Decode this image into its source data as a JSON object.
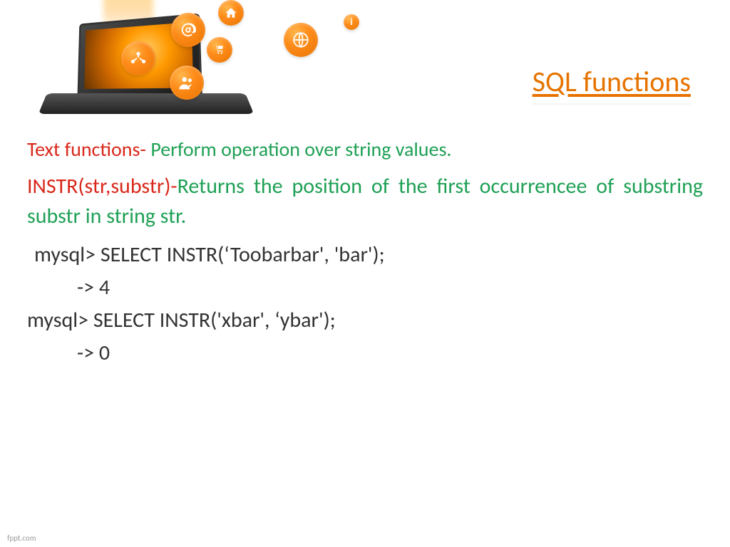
{
  "title": " SQL functions",
  "line1": {
    "label": "Text functions- ",
    "desc": "Perform operation over string values."
  },
  "line2": {
    "func": "INSTR(str,substr)-",
    "desc": "Returns the position of the first occurrencee of substring substr in string str."
  },
  "code": {
    "q1": "mysql> SELECT INSTR(‘Toobarbar', 'bar');",
    "r1": "-> 4",
    "q2": "mysql> SELECT INSTR('xbar', ‘ybar');",
    "r2": "-> 0"
  },
  "footer": "fppt.com",
  "icons": {
    "at": "at-icon",
    "home": "home-icon",
    "cart": "cart-icon",
    "globe": "globe-icon",
    "network": "network-icon",
    "people": "people-icon",
    "info": "info-icon"
  }
}
